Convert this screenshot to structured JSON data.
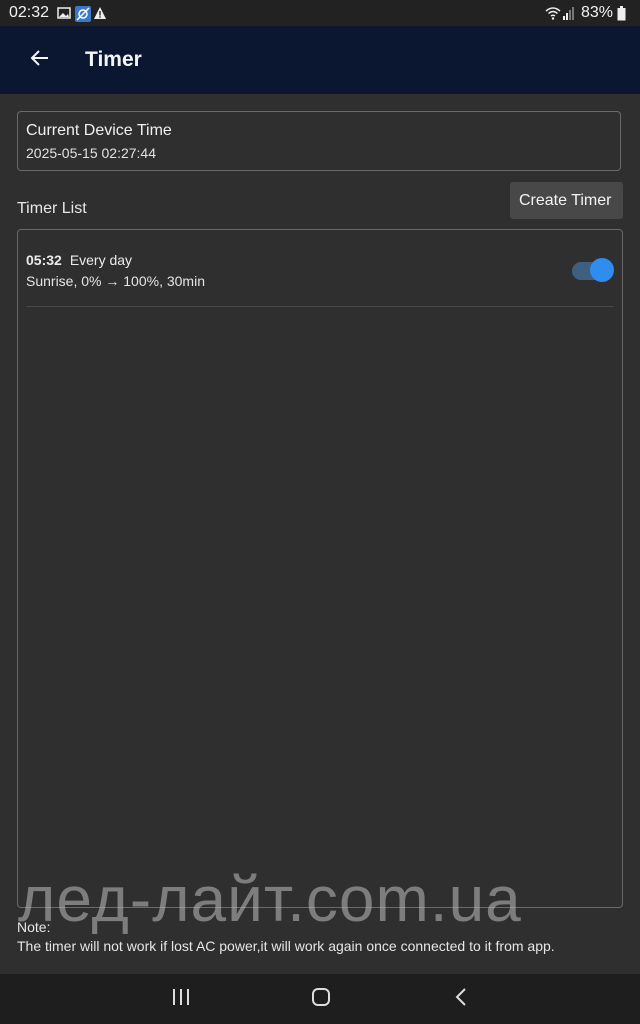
{
  "status_bar": {
    "time": "02:32",
    "battery": "83%",
    "icons_left": [
      "image-icon",
      "location-off-icon",
      "warning-icon"
    ],
    "icons_right": [
      "wifi-icon",
      "signal-icon",
      "battery-icon"
    ]
  },
  "app_bar": {
    "title": "Timer",
    "back_icon": "arrow-left-icon"
  },
  "device_time": {
    "label": "Current Device Time",
    "value": "2025-05-15 02:27:44"
  },
  "timer_list": {
    "label": "Timer List",
    "create_button": "Create Timer",
    "items": [
      {
        "time": "05:32",
        "repeat": "Every day",
        "description": "Sunrise, 0% → 100%, 30min",
        "enabled": true
      }
    ]
  },
  "note": {
    "title": "Note:",
    "text": "The timer will not work if lost AC power,it will work again once connected to it from app."
  },
  "watermark": "лед-лайт.com.ua",
  "colors": {
    "app_bar": "#0b1630",
    "background": "#2f2f2f",
    "toggle_on": "#2f8df0"
  },
  "nav_bar": {
    "icons": [
      "recents-icon",
      "home-icon",
      "back-icon"
    ]
  }
}
